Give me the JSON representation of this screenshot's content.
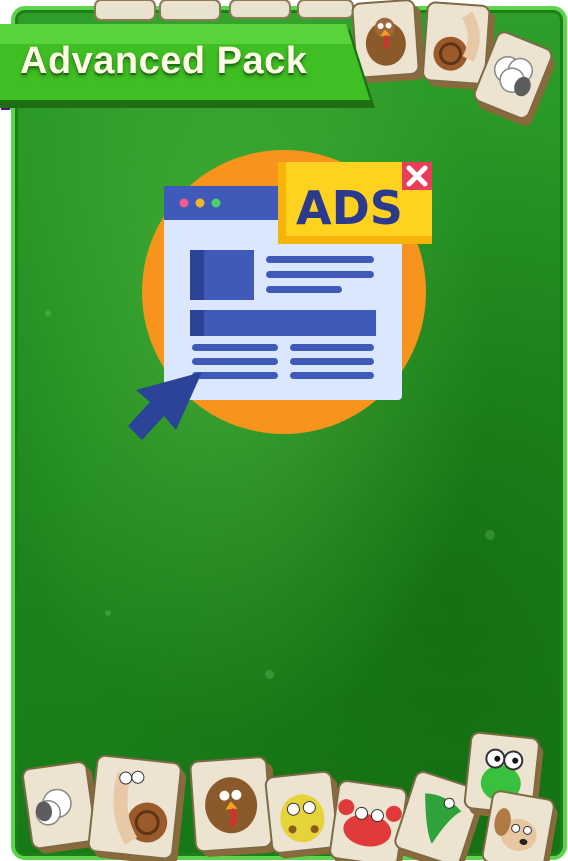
{
  "pack": {
    "title": "Advanced Pack",
    "ads_label": "ADS"
  },
  "colors": {
    "panel_green": "#1f8a1e",
    "panel_border": "#5bd64a",
    "ribbon_green": "#3fbf23",
    "ribbon_dark": "#1d6f12",
    "orange_circle": "#f7941d",
    "ads_yellow": "#ffd21f",
    "ads_text": "#2b3a8c",
    "close_red": "#e83e5a",
    "browser_blue": "#3f5ab8",
    "browser_light": "#dbe6ff"
  },
  "icons": {
    "top_tiles": [
      "turkey-tile-icon",
      "snail-tile-icon",
      "sheep-tile-icon"
    ],
    "bottom_tiles": [
      "sheep-tile-icon",
      "snail-tile-icon",
      "turkey-tile-icon",
      "giraffe-tile-icon",
      "crab-tile-icon",
      "crocodile-tile-icon",
      "frog-tile-icon",
      "dog-tile-icon"
    ]
  }
}
